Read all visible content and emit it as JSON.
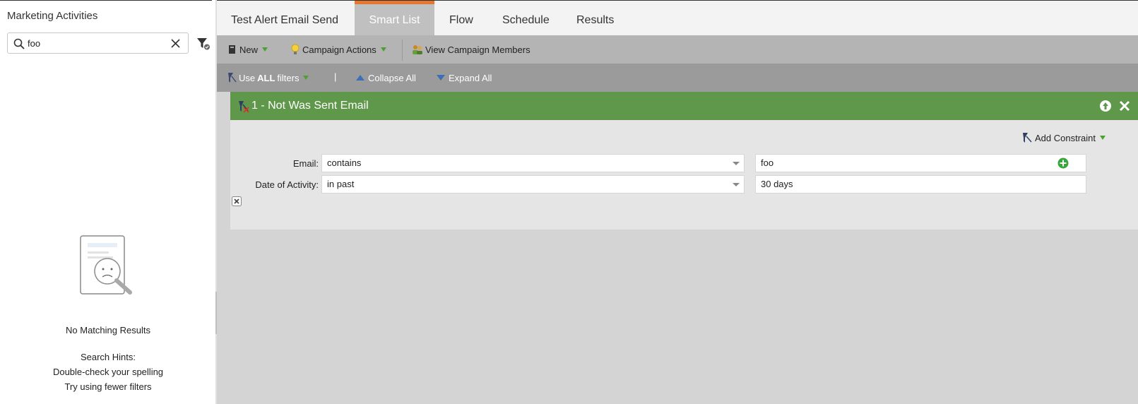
{
  "left_panel": {
    "title": "Marketing Activities",
    "search": {
      "value": "foo",
      "placeholder": ""
    },
    "empty_state": {
      "title": "No Matching Results",
      "hints": [
        "Search Hints:",
        "Double-check your spelling",
        "Try using fewer filters"
      ]
    }
  },
  "tabs": [
    {
      "label": "Test Alert Email Send",
      "active": false
    },
    {
      "label": "Smart List",
      "active": true
    },
    {
      "label": "Flow",
      "active": false
    },
    {
      "label": "Schedule",
      "active": false
    },
    {
      "label": "Results",
      "active": false
    }
  ],
  "toolbar": {
    "new_label": "New",
    "campaign_actions_label": "Campaign Actions",
    "view_members_label": "View Campaign Members"
  },
  "filterbar": {
    "use_prefix": "Use",
    "use_bold": "ALL",
    "use_suffix": "filters",
    "separator": "|",
    "collapse_label": "Collapse All",
    "expand_label": "Expand All"
  },
  "filter": {
    "title": "1 - Not Was Sent Email",
    "add_constraint_label": "Add Constraint",
    "rows": [
      {
        "label": "Email:",
        "operator": "contains",
        "value": "foo"
      },
      {
        "label": "Date of Activity:",
        "operator": "in past",
        "value": "30 days"
      }
    ]
  },
  "colors": {
    "active_tab_accent": "#e8772e",
    "filter_header": "#5f984b",
    "dropdown_arrow_green": "#4aa12f",
    "add_green": "#3aa63a"
  },
  "icons": {
    "search": "search-icon",
    "clear": "close-icon",
    "filter": "filter-icon",
    "new": "document-icon",
    "campaign_actions": "lightbulb-icon",
    "view_members": "people-icon",
    "use_filters": "funnel-icon",
    "collapse": "triangle-up-icon",
    "expand": "triangle-down-icon",
    "move_up": "arrow-up-circle-icon",
    "delete_filter": "close-icon",
    "add_value": "plus-circle-icon",
    "remove_row": "remove-icon"
  }
}
